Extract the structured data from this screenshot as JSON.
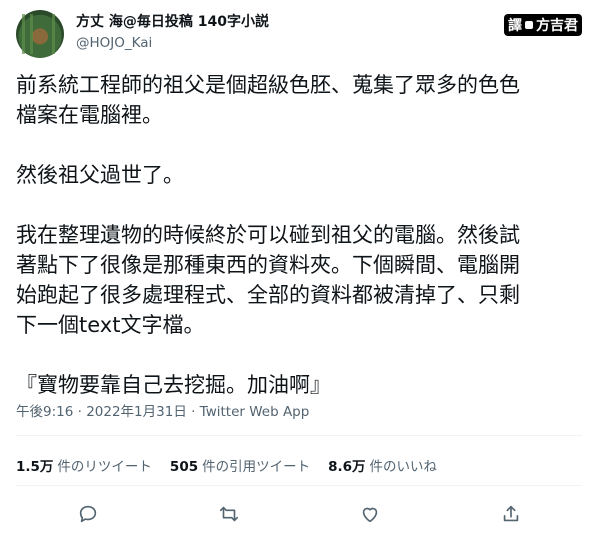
{
  "tweet": {
    "author": {
      "display_name": "方丈 海@毎日投稿 140字小説",
      "handle": "@HOJO_Kai"
    },
    "badge": {
      "left": "譯",
      "right": "方吉君"
    },
    "text": "前系統工程師的祖父是個超級色胚、蒐集了眾多的色色\n檔案在電腦裡。\n\n然後祖父過世了。\n\n我在整理遺物的時候終於可以碰到祖父的電腦。然後試\n著點下了很像是那種東西的資料夾。下個瞬間、電腦開\n始跑起了很多處理程式、全部的資料都被清掉了、只剩\n下一個text文字檔。\n\n『寶物要靠自己去挖掘。加油啊』",
    "meta": "午後9:16 · 2022年1月31日 · Twitter Web App",
    "stats": [
      {
        "value": "1.5万",
        "label": "件のリツイート"
      },
      {
        "value": "505",
        "label": "件の引用ツイート"
      },
      {
        "value": "8.6万",
        "label": "件のいいね"
      }
    ],
    "actions": [
      "reply-icon",
      "retweet-icon",
      "like-icon",
      "share-icon"
    ]
  }
}
